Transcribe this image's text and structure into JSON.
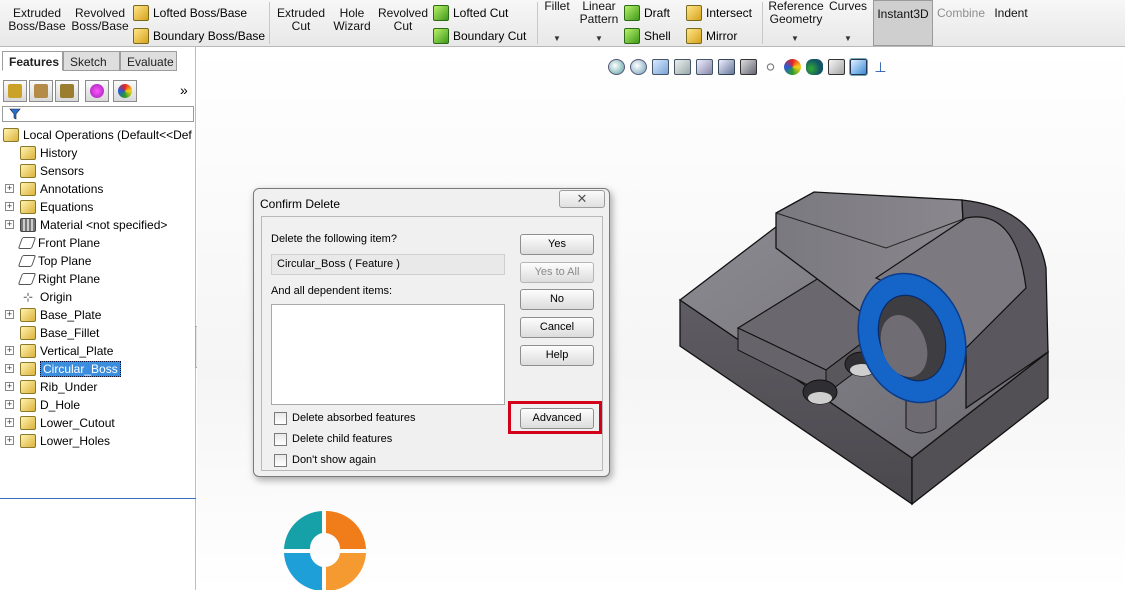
{
  "ribbon": {
    "extruded_boss": "Extruded\nBoss/Base",
    "revolved_boss": "Revolved\nBoss/Base",
    "lofted_boss": "Lofted Boss/Base",
    "boundary_boss": "Boundary Boss/Base",
    "extruded_cut": "Extruded\nCut",
    "hole_wizard": "Hole\nWizard",
    "revolved_cut": "Revolved\nCut",
    "lofted_cut": "Lofted Cut",
    "boundary_cut": "Boundary Cut",
    "fillet": "Fillet",
    "linear_pattern": "Linear\nPattern",
    "draft": "Draft",
    "shell": "Shell",
    "intersect": "Intersect",
    "mirror": "Mirror",
    "reference_geometry": "Reference\nGeometry",
    "curves": "Curves",
    "instant3d": "Instant3D",
    "combine": "Combine",
    "indent": "Indent"
  },
  "panel": {
    "tabs": [
      "Features",
      "Sketch",
      "Evaluate"
    ],
    "expand_glyph": "»"
  },
  "tree": {
    "root": "Local Operations  (Default<<Def",
    "items": [
      {
        "label": "History",
        "icon": "history-icon",
        "expandable": false
      },
      {
        "label": "Sensors",
        "icon": "sensors-icon",
        "expandable": false
      },
      {
        "label": "Annotations",
        "icon": "annotations-icon",
        "expandable": true
      },
      {
        "label": "Equations",
        "icon": "equations-icon",
        "expandable": true
      },
      {
        "label": "Material <not specified>",
        "icon": "material-icon",
        "expandable": true
      },
      {
        "label": "Front Plane",
        "icon": "plane-icon",
        "expandable": false
      },
      {
        "label": "Top Plane",
        "icon": "plane-icon",
        "expandable": false
      },
      {
        "label": "Right Plane",
        "icon": "plane-icon",
        "expandable": false
      },
      {
        "label": "Origin",
        "icon": "origin-icon",
        "expandable": false
      },
      {
        "label": "Base_Plate",
        "icon": "extrude-feature-icon",
        "expandable": true
      },
      {
        "label": "Base_Fillet",
        "icon": "fillet-feature-icon",
        "expandable": false
      },
      {
        "label": "Vertical_Plate",
        "icon": "extrude-feature-icon",
        "expandable": true
      },
      {
        "label": "Circular_Boss",
        "icon": "extrude-feature-icon",
        "expandable": true,
        "selected": true
      },
      {
        "label": "Rib_Under",
        "icon": "extrude-feature-icon",
        "expandable": true
      },
      {
        "label": "D_Hole",
        "icon": "cut-feature-icon",
        "expandable": true
      },
      {
        "label": "Lower_Cutout",
        "icon": "cut-feature-icon",
        "expandable": true
      },
      {
        "label": "Lower_Holes",
        "icon": "cut-feature-icon",
        "expandable": true
      }
    ]
  },
  "dialog": {
    "title": "Confirm Delete",
    "close_glyph": "✕",
    "delete_prompt": "Delete the following item?",
    "item_value": "Circular_Boss ( Feature )",
    "dependents_label": "And all dependent items:",
    "buttons": {
      "yes": "Yes",
      "yes_to_all": "Yes to All",
      "no": "No",
      "cancel": "Cancel",
      "help": "Help",
      "advanced": "Advanced"
    },
    "checkboxes": {
      "absorbed": "Delete absorbed features",
      "child": "Delete child features",
      "dont_show": "Don't show again"
    }
  },
  "colors": {
    "selection_blue": "#3b8ede",
    "boss_face_blue": "#1565c8",
    "highlight_red": "#d4001a",
    "part_gray": "#7a7880"
  }
}
